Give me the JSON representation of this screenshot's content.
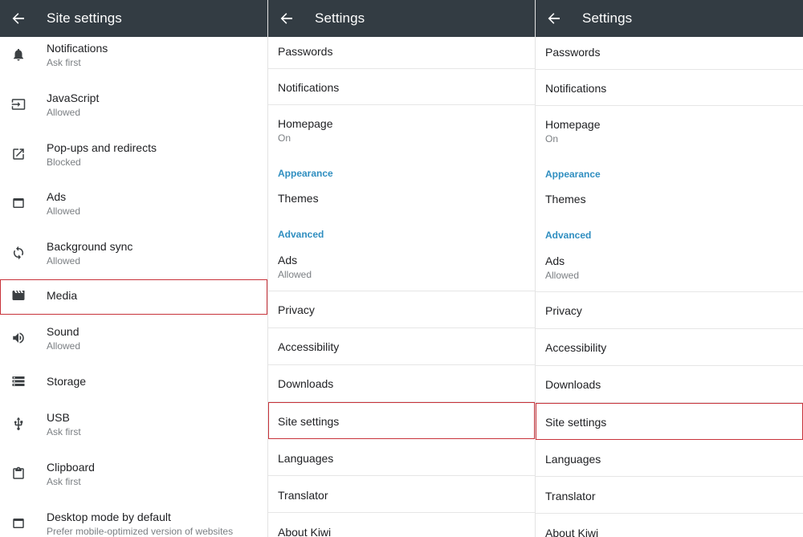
{
  "panels": {
    "site_settings": {
      "title": "Site settings",
      "items": [
        {
          "title": "Notifications",
          "subtitle": "Ask first",
          "icon": "bell-icon"
        },
        {
          "title": "JavaScript",
          "subtitle": "Allowed",
          "icon": "javascript-icon"
        },
        {
          "title": "Pop-ups and redirects",
          "subtitle": "Blocked",
          "icon": "popup-icon"
        },
        {
          "title": "Ads",
          "subtitle": "Allowed",
          "icon": "ads-icon"
        },
        {
          "title": "Background sync",
          "subtitle": "Allowed",
          "icon": "sync-icon"
        },
        {
          "title": "Media",
          "subtitle": "",
          "icon": "media-clapper-icon"
        },
        {
          "title": "Sound",
          "subtitle": "Allowed",
          "icon": "speaker-icon"
        },
        {
          "title": "Storage",
          "subtitle": "",
          "icon": "storage-icon"
        },
        {
          "title": "USB",
          "subtitle": "Ask first",
          "icon": "usb-icon"
        },
        {
          "title": "Clipboard",
          "subtitle": "Ask first",
          "icon": "clipboard-icon"
        },
        {
          "title": "Desktop mode by default",
          "subtitle": "Prefer mobile-optimized version of websites",
          "icon": "desktop-icon"
        }
      ]
    },
    "settings": {
      "title": "Settings",
      "items": [
        {
          "title": "Passwords",
          "subtitle": ""
        },
        {
          "title": "Notifications",
          "subtitle": ""
        },
        {
          "title": "Homepage",
          "subtitle": "On"
        },
        {
          "header": "Appearance"
        },
        {
          "title": "Themes",
          "subtitle": ""
        },
        {
          "header": "Advanced"
        },
        {
          "title": "Ads",
          "subtitle": "Allowed"
        },
        {
          "title": "Privacy",
          "subtitle": ""
        },
        {
          "title": "Accessibility",
          "subtitle": ""
        },
        {
          "title": "Downloads",
          "subtitle": ""
        },
        {
          "title": "Site settings",
          "subtitle": ""
        },
        {
          "title": "Languages",
          "subtitle": ""
        },
        {
          "title": "Translator",
          "subtitle": ""
        },
        {
          "title": "About Kiwi",
          "subtitle": ""
        }
      ]
    }
  },
  "highlights": {
    "panel1": "Media",
    "panel2": "Site settings",
    "panel3": "Site settings"
  },
  "colors": {
    "appbar": "#333c43",
    "section_header": "#2f8ec0",
    "highlight_border": "#c8323a"
  }
}
